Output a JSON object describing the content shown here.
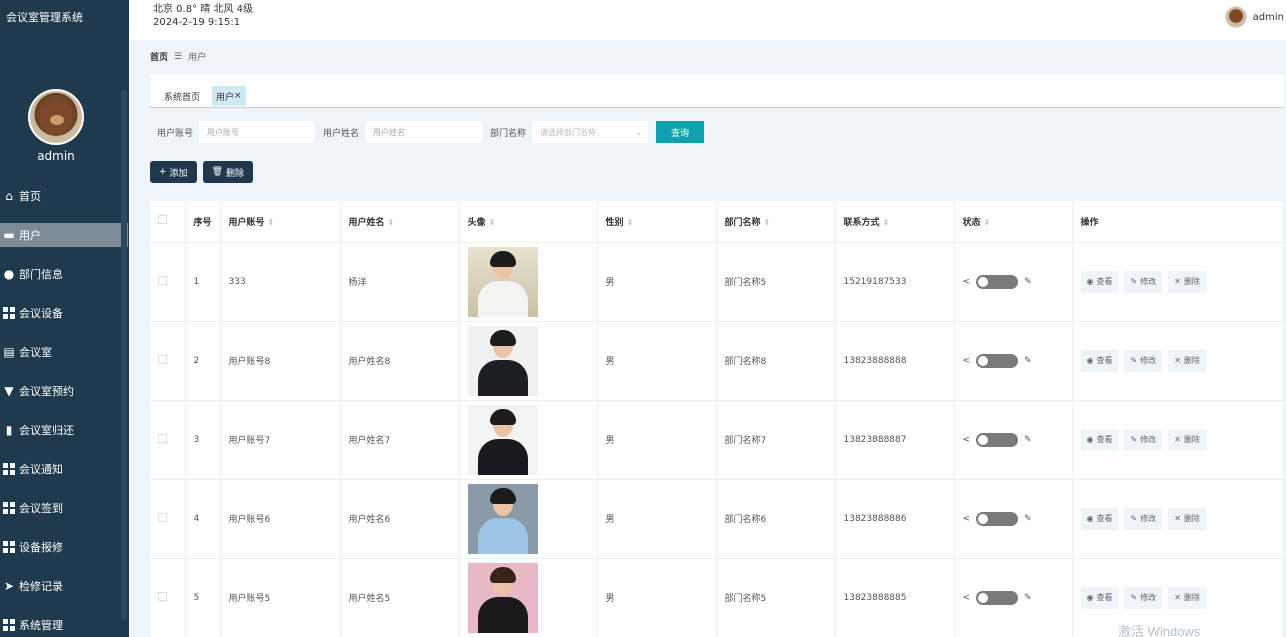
{
  "app": {
    "title": "会议室管理系统"
  },
  "header": {
    "weather": "北京  0.8°  晴  北风  4级",
    "datetime": "2024-2-19 9:15:1",
    "username": "admin"
  },
  "sidebar": {
    "username": "admin",
    "items": [
      {
        "label": "首页",
        "icon": "home-icon"
      },
      {
        "label": "用户",
        "icon": "briefcase-icon",
        "active": true
      },
      {
        "label": "部门信息",
        "icon": "person-icon"
      },
      {
        "label": "会议设备",
        "icon": "grid-icon"
      },
      {
        "label": "会议室",
        "icon": "clipboard-icon"
      },
      {
        "label": "会议室预约",
        "icon": "signpost-icon"
      },
      {
        "label": "会议室归还",
        "icon": "bar-chart-icon"
      },
      {
        "label": "会议通知",
        "icon": "grid-icon"
      },
      {
        "label": "会议签到",
        "icon": "grid-icon"
      },
      {
        "label": "设备报修",
        "icon": "grid-icon"
      },
      {
        "label": "检修记录",
        "icon": "send-icon"
      },
      {
        "label": "系统管理",
        "icon": "grid-icon"
      }
    ]
  },
  "breadcrumb": {
    "home": "首页",
    "separator": "☰",
    "current": "用户"
  },
  "tabs": {
    "home": "系统首页",
    "current": "用户",
    "close": "×"
  },
  "search": {
    "account_label": "用户账号",
    "account_placeholder": "用户账号",
    "name_label": "用户姓名",
    "name_placeholder": "用户姓名",
    "dept_label": "部门名称",
    "dept_placeholder": "请选择部门名称",
    "query_button": "查询"
  },
  "actions": {
    "add": "添加",
    "delete": "删除"
  },
  "table": {
    "headers": [
      "序号",
      "用户账号",
      "用户姓名",
      "头像",
      "性别",
      "部门名称",
      "联系方式",
      "状态",
      "操作"
    ],
    "op_view": "查看",
    "op_edit": "修改",
    "op_delete": "删除",
    "rows": [
      {
        "no": "1",
        "account": "333",
        "name": "杨洋",
        "gender": "男",
        "dept": "部门名称5",
        "phone": "15219187533"
      },
      {
        "no": "2",
        "account": "用户账号8",
        "name": "用户姓名8",
        "gender": "男",
        "dept": "部门名称8",
        "phone": "13823888888"
      },
      {
        "no": "3",
        "account": "用户账号7",
        "name": "用户姓名7",
        "gender": "男",
        "dept": "部门名称7",
        "phone": "13823888887"
      },
      {
        "no": "4",
        "account": "用户账号6",
        "name": "用户姓名6",
        "gender": "男",
        "dept": "部门名称6",
        "phone": "13823888886"
      },
      {
        "no": "5",
        "account": "用户账号5",
        "name": "用户姓名5",
        "gender": "男",
        "dept": "部门名称5",
        "phone": "13823888885"
      }
    ]
  },
  "colors": {
    "sidebar": "#1f3a4d",
    "accent": "#11a0ae",
    "toggle_off": "#7a7a7a"
  },
  "watermark": "激活 Windows"
}
